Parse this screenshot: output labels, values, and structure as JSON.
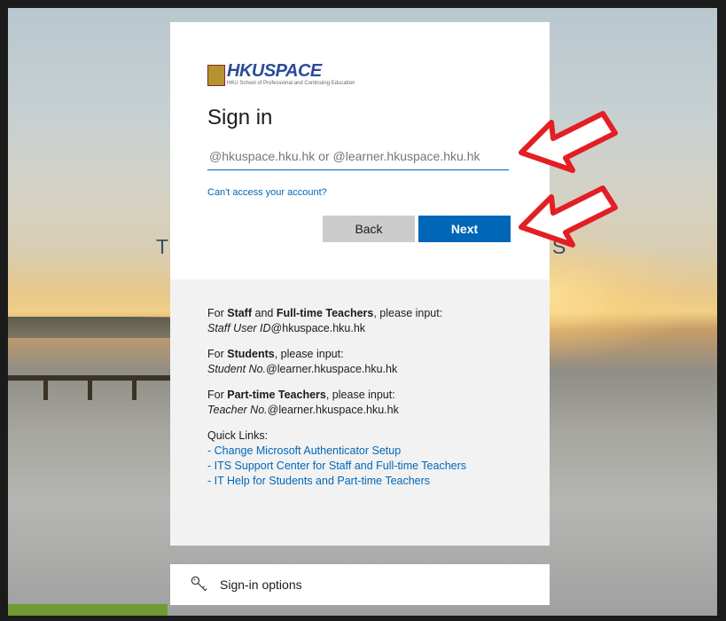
{
  "brand": {
    "logo_text": "HKUSPACE",
    "logo_subtitle": "HKU School of Professional and Continuing Education"
  },
  "background": {
    "letter_left": "T",
    "letter_right": "S"
  },
  "signin": {
    "title": "Sign in",
    "email_placeholder": "@hkuspace.hku.hk or @learner.hkuspace.hku.hk",
    "email_value": "",
    "cant_access": "Can't access your account?",
    "back_label": "Back",
    "next_label": "Next"
  },
  "info": {
    "staff_prefix": "For ",
    "staff_bold1": "Staff",
    "staff_and": " and ",
    "staff_bold2": "Full-time Teachers",
    "staff_suffix": ", please input:",
    "staff_id_italic": "Staff User ID",
    "staff_domain": "@hkuspace.hku.hk",
    "student_prefix": "For ",
    "student_bold": "Students",
    "student_suffix": ", please input:",
    "student_id_italic": "Student No.",
    "student_domain": "@learner.hkuspace.hku.hk",
    "pt_prefix": "For ",
    "pt_bold": "Part-time Teachers",
    "pt_suffix": ", please input:",
    "pt_id_italic": "Teacher No.",
    "pt_domain": "@learner.hkuspace.hku.hk",
    "quick_links_title": "Quick Links:",
    "quick_links": [
      "- Change Microsoft Authenticator Setup",
      "- ITS Support Center for Staff and Full-time Teachers",
      "- IT Help for Students and Part-time Teachers"
    ]
  },
  "options": {
    "label": "Sign-in options",
    "icon": "key-icon"
  },
  "annotations": {
    "arrow_color": "#e31e24"
  },
  "colors": {
    "accent": "#0067b8",
    "back_button": "#cccccc",
    "panel_gray": "#f2f2f2"
  }
}
